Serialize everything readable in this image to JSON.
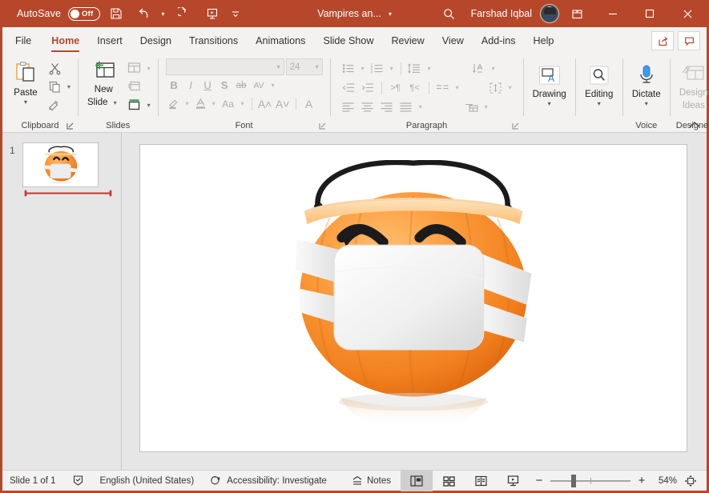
{
  "titlebar": {
    "autosave_label": "AutoSave",
    "autosave_state": "Off",
    "save_icon": "save-icon",
    "undo_icon": "undo-icon",
    "redo_icon": "redo-icon",
    "present_icon": "start-presentation-icon",
    "customize_icon": "customize-quick-access-toolbar-icon",
    "document_title": "Vampires an...",
    "search_icon": "search-icon",
    "user_name": "Farshad Iqbal",
    "avatar": "user-avatar",
    "ribbon_display_icon": "ribbon-display-options-icon",
    "minimize": "minimize-icon",
    "maximize": "maximize-icon",
    "close": "close-icon",
    "accent_color": "#b7472a"
  },
  "tabs": [
    {
      "label": "File",
      "active": false
    },
    {
      "label": "Home",
      "active": true
    },
    {
      "label": "Insert",
      "active": false
    },
    {
      "label": "Design",
      "active": false
    },
    {
      "label": "Transitions",
      "active": false
    },
    {
      "label": "Animations",
      "active": false
    },
    {
      "label": "Slide Show",
      "active": false
    },
    {
      "label": "Review",
      "active": false
    },
    {
      "label": "View",
      "active": false
    },
    {
      "label": "Add-ins",
      "active": false
    },
    {
      "label": "Help",
      "active": false
    }
  ],
  "tabbar_right": {
    "share_label": "share-icon",
    "comments_label": "comments-icon"
  },
  "ribbon": {
    "collapse_icon": "collapse-ribbon-icon",
    "groups": [
      {
        "name": "Clipboard",
        "title": "Clipboard",
        "paste_label": "Paste",
        "cut_label": "Cut",
        "copy_label": "Copy",
        "format_painter_label": "Format Painter",
        "has_launcher": true
      },
      {
        "name": "Slides",
        "title": "Slides",
        "new_slide_label": "New\nSlide",
        "new_slide_line1": "New",
        "new_slide_line2": "Slide",
        "layout_label": "Layout",
        "reset_label": "Reset",
        "section_label": "Section",
        "has_launcher": false
      },
      {
        "name": "Font",
        "title": "Font",
        "font_name_value": "",
        "font_size_value": "24",
        "bold": "B",
        "italic": "I",
        "underline": "U",
        "shadow": "S",
        "strikethrough": "ab",
        "char_spacing": "AV",
        "text_highlight": "text-highlight-color-icon",
        "font_color": "A",
        "change_case": "Aa",
        "increase_size": "A",
        "decrease_size": "A",
        "clear_formatting": "clear-formatting-icon",
        "has_launcher": true,
        "disabled": true
      },
      {
        "name": "Paragraph",
        "title": "Paragraph",
        "bullets": "bullets-icon",
        "numbering": "numbering-icon",
        "line_spacing": "line-spacing-icon",
        "text_direction": "text-direction-icon",
        "decrease_indent": "decrease-indent-icon",
        "increase_indent": "increase-indent-icon",
        "ltr": "left-to-right-icon",
        "rtl": "right-to-left-icon",
        "columns": "columns-icon",
        "align_text": "align-text-icon",
        "align_left": "align-left-icon",
        "align_center": "align-center-icon",
        "align_right": "align-right-icon",
        "justify": "justify-icon",
        "smartart": "convert-to-smartart-icon",
        "has_launcher": true,
        "disabled": true
      },
      {
        "name": "Drawing",
        "title": "",
        "label": "Drawing",
        "icon": "drawing-shapes-icon"
      },
      {
        "name": "Editing",
        "title": "",
        "label": "Editing",
        "icon": "editing-find-icon"
      },
      {
        "name": "Voice",
        "title": "Voice",
        "label": "Dictate",
        "icon": "microphone-icon"
      },
      {
        "name": "Designer",
        "title": "Designer",
        "label_line1": "Design",
        "label_line2": "Ideas",
        "icon": "design-ideas-icon",
        "disabled": true
      }
    ]
  },
  "thumbnails": {
    "slides": [
      {
        "number": "1",
        "selected": true,
        "art": "pumpkin-bucket-with-mask"
      }
    ],
    "timing_bar": "animation-timing-bar"
  },
  "slide": {
    "art": "pumpkin-bucket-with-face-mask",
    "background": "#ffffff"
  },
  "statusbar": {
    "slide_count": "Slide 1 of 1",
    "spellcheck_icon": "spellcheck-icon",
    "language": "English (United States)",
    "accessibility_icon": "accessibility-icon",
    "accessibility": "Accessibility: Investigate",
    "notes_label": "Notes",
    "notes_icon": "notes-chevron-icon",
    "views": [
      {
        "name": "normal-view",
        "icon": "normal-view-icon",
        "active": true
      },
      {
        "name": "slide-sorter-view",
        "icon": "slide-sorter-icon",
        "active": false
      },
      {
        "name": "reading-view",
        "icon": "reading-view-icon",
        "active": false
      },
      {
        "name": "slide-show-view",
        "icon": "slide-show-icon",
        "active": false
      }
    ],
    "zoom_out": "−",
    "zoom_in": "+",
    "zoom_value": "54%",
    "fit_slide_icon": "fit-slide-to-window-icon"
  }
}
